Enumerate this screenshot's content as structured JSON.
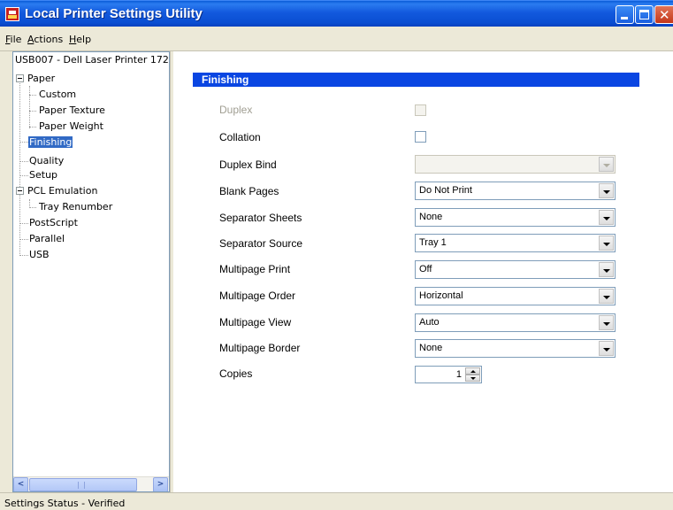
{
  "window": {
    "title": "Local Printer Settings Utility",
    "colors": {
      "titlebar": "#0a4ed2",
      "close_button": "#c4371a",
      "section_header": "#0a46e2",
      "selection": "#316ac5"
    }
  },
  "menu": [
    {
      "accel": "F",
      "rest": "ile"
    },
    {
      "accel": "A",
      "rest": "ctions"
    },
    {
      "accel": "H",
      "rest": "elp"
    }
  ],
  "tree": {
    "root": "USB007 - Dell Laser Printer 172",
    "items": [
      {
        "label": "Paper",
        "expanded": true
      },
      {
        "label": "Custom"
      },
      {
        "label": "Paper Texture"
      },
      {
        "label": "Paper Weight"
      },
      {
        "label": "Finishing",
        "selected": true
      },
      {
        "label": "Quality"
      },
      {
        "label": "Setup"
      },
      {
        "label": "PCL Emulation",
        "expanded": true
      },
      {
        "label": "Tray Renumber"
      },
      {
        "label": "PostScript"
      },
      {
        "label": "Parallel"
      },
      {
        "label": "USB"
      }
    ]
  },
  "section": {
    "title": "Finishing",
    "fields": {
      "duplex": {
        "label": "Duplex",
        "checked": false,
        "enabled": false
      },
      "collation": {
        "label": "Collation",
        "checked": false,
        "enabled": true
      },
      "duplex_bind": {
        "label": "Duplex Bind",
        "value": "",
        "enabled": false
      },
      "blank_pages": {
        "label": "Blank Pages",
        "value": "Do Not Print"
      },
      "separator_sheets": {
        "label": "Separator Sheets",
        "value": "None"
      },
      "separator_source": {
        "label": "Separator Source",
        "value": "Tray 1"
      },
      "multipage_print": {
        "label": "Multipage Print",
        "value": "Off"
      },
      "multipage_order": {
        "label": "Multipage Order",
        "value": "Horizontal"
      },
      "multipage_view": {
        "label": "Multipage View",
        "value": "Auto"
      },
      "multipage_border": {
        "label": "Multipage Border",
        "value": "None"
      },
      "copies": {
        "label": "Copies",
        "value": "1"
      }
    }
  },
  "status": "Settings Status - Verified"
}
